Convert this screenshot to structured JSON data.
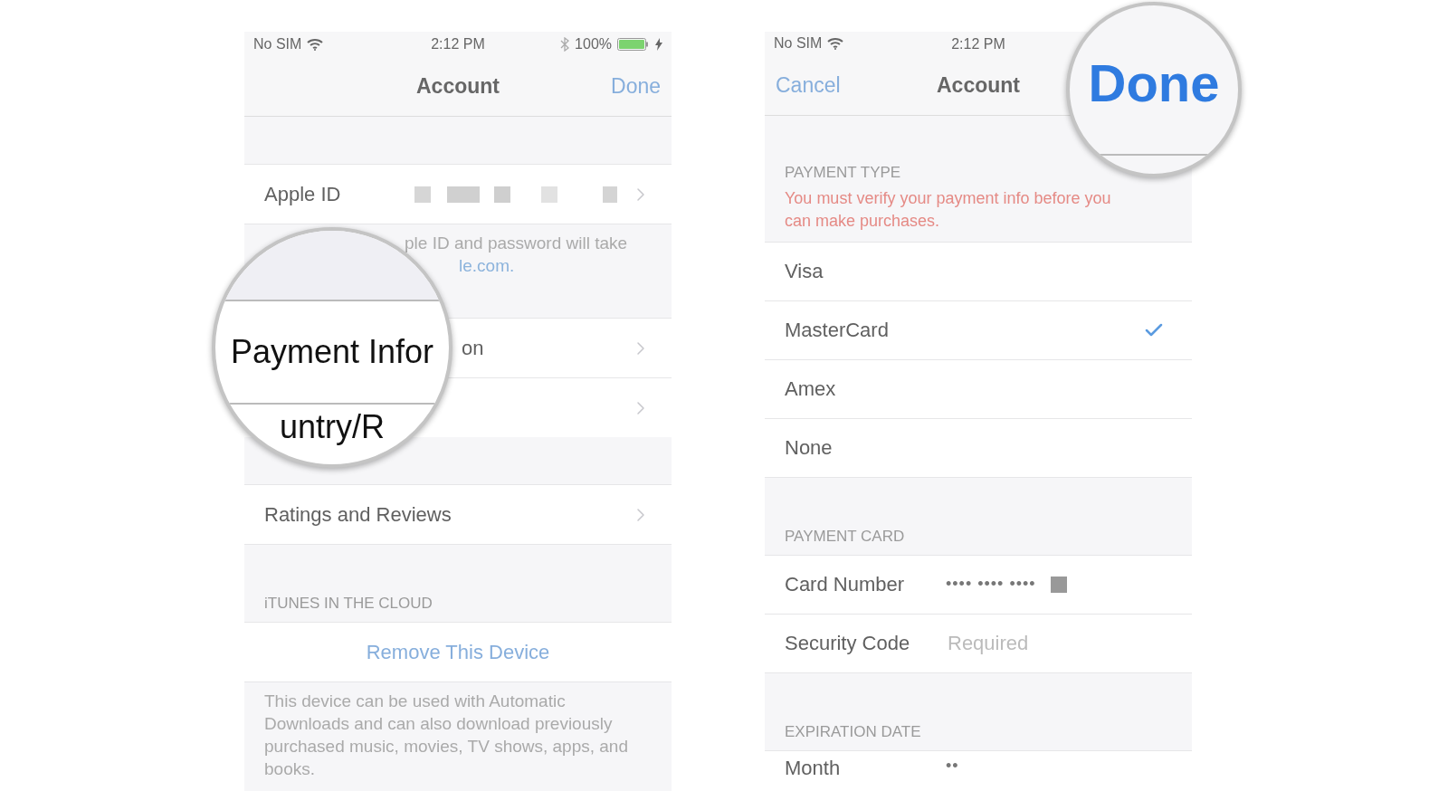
{
  "left_screen": {
    "status_bar": {
      "carrier": "No SIM",
      "time": "2:12 PM",
      "battery": "100%",
      "charging": true
    },
    "nav": {
      "title": "Account",
      "done": "Done"
    },
    "blocks": [
      {
        "kind": "gap"
      },
      {
        "kind": "row",
        "label": "Apple ID",
        "redacted": true
      },
      {
        "kind": "footer",
        "lines": [
          "ple ID and password will take"
        ],
        "link": "le.com."
      },
      {
        "kind": "covered_row",
        "label": "on"
      },
      {
        "kind": "covered_row"
      },
      {
        "kind": "gap"
      },
      {
        "kind": "row",
        "label": "Ratings and Reviews"
      },
      {
        "kind": "header",
        "text": "iTUNES IN THE CLOUD"
      },
      {
        "kind": "action",
        "text": "Remove This Device"
      },
      {
        "kind": "note",
        "text": "This device can be used with Automatic Downloads and can also download previously purchased music, movies, TV shows, apps, and books."
      }
    ],
    "magnifier": {
      "lines": [
        "Payment Infor",
        "untry/R"
      ]
    }
  },
  "right_screen": {
    "status_bar": {
      "carrier": "No SIM",
      "time": "2:12 PM"
    },
    "nav": {
      "cancel": "Cancel",
      "title": "Account"
    },
    "payment_type": {
      "header": "PAYMENT TYPE",
      "warning": "You must verify your payment info before you can make purchases.",
      "options": [
        {
          "label": "Visa",
          "selected": false
        },
        {
          "label": "MasterCard",
          "selected": true
        },
        {
          "label": "Amex",
          "selected": false
        },
        {
          "label": "None",
          "selected": false
        }
      ]
    },
    "payment_card": {
      "header": "PAYMENT CARD",
      "fields": [
        {
          "label": "Card Number",
          "value": "•••• •••• ••••",
          "redacted": true
        },
        {
          "label": "Security Code",
          "placeholder": "Required"
        }
      ]
    },
    "expiration_date": {
      "header": "EXPIRATION DATE",
      "fields": [
        {
          "label": "Month",
          "value": "••"
        }
      ]
    },
    "magnifier": {
      "text": "Done"
    }
  }
}
